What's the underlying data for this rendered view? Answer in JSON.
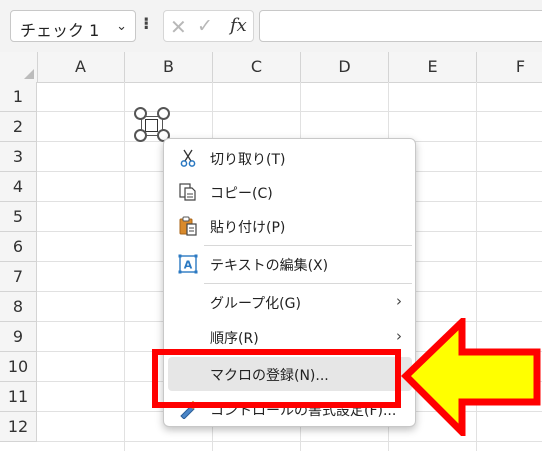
{
  "formula_bar": {
    "name_box_value": "チェック 1",
    "name_box_arrow": "⌄",
    "kebab": "⁝",
    "cancel_glyph": "✕",
    "enter_glyph": "✓",
    "fx_label": "fx",
    "formula_value": ""
  },
  "columns": [
    "A",
    "B",
    "C",
    "D",
    "E",
    "F"
  ],
  "rows": [
    "1",
    "2",
    "3",
    "4",
    "5",
    "6",
    "7",
    "8",
    "9",
    "10",
    "11",
    "12"
  ],
  "context_menu": {
    "items": [
      {
        "label": "切り取り(T)",
        "icon": "scissors-icon"
      },
      {
        "label": "コピー(C)",
        "icon": "copy-icon"
      },
      {
        "label": "貼り付け(P)",
        "icon": "paste-icon"
      },
      {
        "label": "テキストの編集(X)",
        "icon": "text-box-icon"
      },
      {
        "label": "グループ化(G)",
        "icon": "",
        "submenu_glyph": "›"
      },
      {
        "label": "順序(R)",
        "icon": "",
        "submenu_glyph": "›"
      },
      {
        "label": "マクロの登録(N)...",
        "icon": "",
        "highlighted": true
      },
      {
        "label": "コントロールの書式設定(F)...",
        "icon": "format-control-icon"
      }
    ]
  },
  "colors": {
    "annotation_red": "#ff0000",
    "arrow_yellow": "#ffff00",
    "highlight": "#e6e6e6",
    "icon_blue": "#2b79c2",
    "icon_orange": "#d98a2b"
  }
}
